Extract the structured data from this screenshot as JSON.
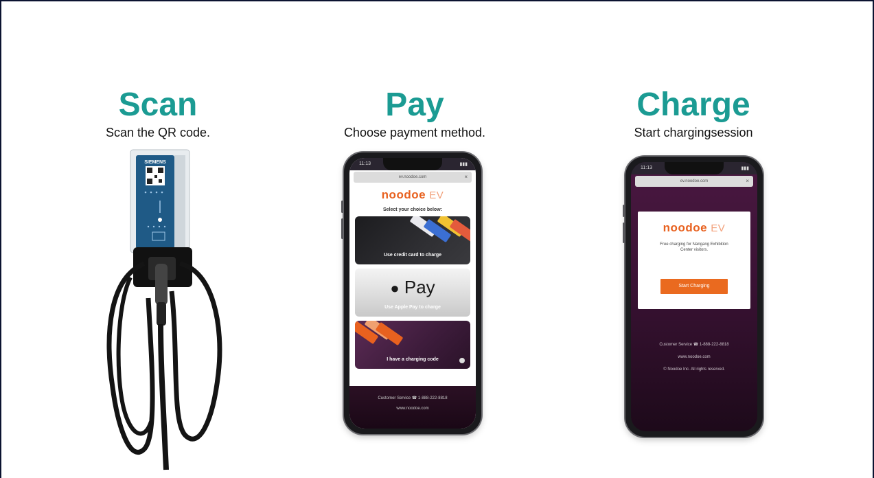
{
  "steps": [
    {
      "title": "Scan",
      "caption": "Scan the QR code."
    },
    {
      "title": "Pay",
      "caption": "Choose payment method."
    },
    {
      "title": "Charge",
      "caption": "Start chargingsession"
    }
  ],
  "charger": {
    "brand": "SIEMENS"
  },
  "pay_phone": {
    "status_time": "11:13",
    "url": "ev.noodoe.com",
    "logo": "noodoe",
    "logo_suffix": "EV",
    "select_text": "Select your choice below:",
    "options": [
      {
        "label": "Use credit card to charge"
      },
      {
        "label": "Use Apple Pay to charge",
        "brand": "Pay"
      },
      {
        "label": "I have a charging code"
      }
    ],
    "footer": {
      "service": "Customer Service  ☎  1-888-222-8818",
      "site": "www.noodoe.com"
    }
  },
  "charge_phone": {
    "status_time": "11:13",
    "url": "ev.noodoe.com",
    "logo": "noodoe",
    "logo_suffix": "EV",
    "message": "Free charging for Nangang Exhibition Center visitors.",
    "button": "Start Charging",
    "footer": {
      "service": "Customer Service  ☎  1-888-222-8818",
      "site": "www.noodoe.com",
      "copyright": "© Noodoe Inc. All rights reserved."
    }
  },
  "colors": {
    "accent": "#1b9b93",
    "brand_orange": "#e8611f"
  }
}
